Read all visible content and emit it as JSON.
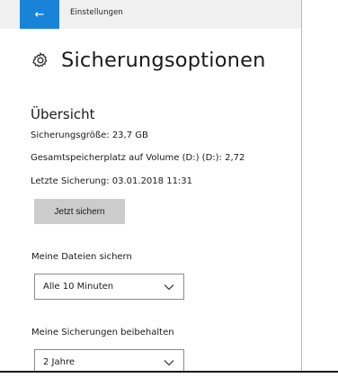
{
  "titlebar": {
    "back_icon": "←",
    "app_title": "Einstellungen"
  },
  "header": {
    "icon": "gear-icon",
    "title": "Sicherungsoptionen"
  },
  "overview": {
    "heading": "Übersicht",
    "backup_size": "Sicherungsgröße: 23,7 GB",
    "total_storage": "Gesamtspeicherplatz auf Volume (D:) (D:): 2,72",
    "last_backup": "Letzte Sicherung: 03.01.2018 11:31",
    "backup_now_label": "Jetzt sichern"
  },
  "backup_files": {
    "label": "Meine Dateien sichern",
    "selected": "Alle 10 Minuten"
  },
  "keep_backups": {
    "label": "Meine Sicherungen beibehalten",
    "selected": "2 Jahre"
  },
  "colors": {
    "accent": "#1883d7",
    "button_bg": "#cccccc",
    "titlebar_bg": "#f0f0f0"
  }
}
